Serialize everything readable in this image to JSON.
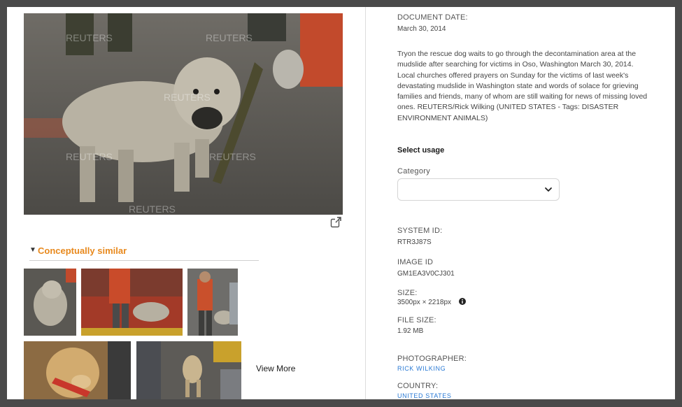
{
  "photo": {
    "alt": "Muddy dog on leash",
    "watermark": "REUTERS"
  },
  "similar": {
    "title": "Conceptually similar",
    "view_more": "View More"
  },
  "metadata": {
    "document_date_label": "DOCUMENT DATE:",
    "document_date": "March 30, 2014",
    "description": "Tryon the rescue dog waits to go through the decontamination area at the mudslide after searching for victims in Oso, Washington March 30, 2014. Local churches offered prayers on Sunday for the victims of last week's devastating mudslide in Washington state and words of solace for grieving families and friends, many of whom are still waiting for news of missing loved ones. REUTERS/Rick Wilking (UNITED STATES - Tags: DISASTER ENVIRONMENT ANIMALS)",
    "select_usage": "Select usage",
    "category_label": "Category",
    "category_value": "",
    "system_id_label": "SYSTEM ID:",
    "system_id": "RTR3J87S",
    "image_id_label": "IMAGE ID",
    "image_id": "GM1EA3V0CJ301",
    "size_label": "SIZE:",
    "size": "3500px × 2218px",
    "file_size_label": "FILE SIZE:",
    "file_size": "1.92 MB",
    "photographer_label": "PHOTOGRAPHER:",
    "photographer": "RICK WILKING",
    "country_label": "COUNTRY:",
    "country": "UNITED STATES"
  },
  "colors": {
    "accent": "#e8891d",
    "link": "#2a7ad5"
  },
  "icons": [
    "external-link-icon",
    "caret-down-icon",
    "chevron-down-icon",
    "info-icon"
  ]
}
